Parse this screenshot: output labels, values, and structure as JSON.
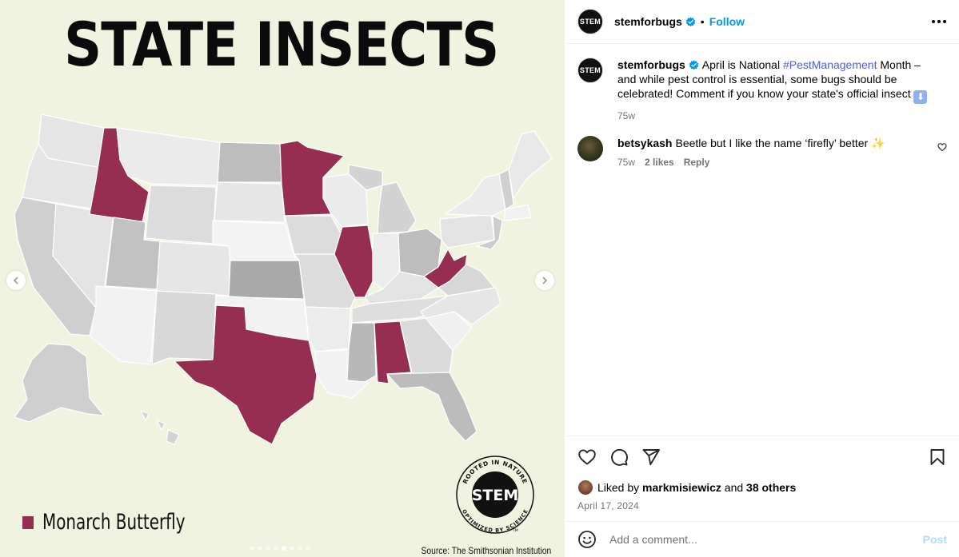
{
  "media": {
    "title": "STATE INSECTS",
    "legend_label": "Monarch Butterfly",
    "source": "Source: The Smithsonian Institution",
    "badge": {
      "center": "STEM",
      "top_arc": "ROOTED IN NATURE",
      "bottom_arc": "OPTIMIZED BY SCIENCE",
      "tm": "TM"
    },
    "carousel": {
      "count": 8,
      "active_index": 4
    },
    "colors": {
      "highlight": "#962e52",
      "background": "#f0f3df"
    }
  },
  "header": {
    "avatar_text": "STEM",
    "username": "stemforbugs",
    "separator": "•",
    "follow_label": "Follow"
  },
  "caption": {
    "avatar_text": "STEM",
    "username": "stemforbugs",
    "text_before": "April is National ",
    "hashtag": "#PestManagement",
    "text_after": " Month – and while pest control is essential, some bugs should be celebrated! Comment if you know your state's official insect ",
    "emoji": "⬇",
    "time": "75w"
  },
  "comment": {
    "username": "betsykash",
    "text": "Beetle but I like the name ‘firefly’ better ",
    "emoji": "✨",
    "time": "75w",
    "likes": "2 likes",
    "reply": "Reply"
  },
  "actions": {
    "liked_prefix": "Liked by ",
    "liked_user": "markmisiewicz",
    "liked_and": " and ",
    "liked_others": "38 others",
    "date": "April 17, 2024"
  },
  "add_comment": {
    "placeholder": "Add a comment...",
    "post_label": "Post"
  }
}
